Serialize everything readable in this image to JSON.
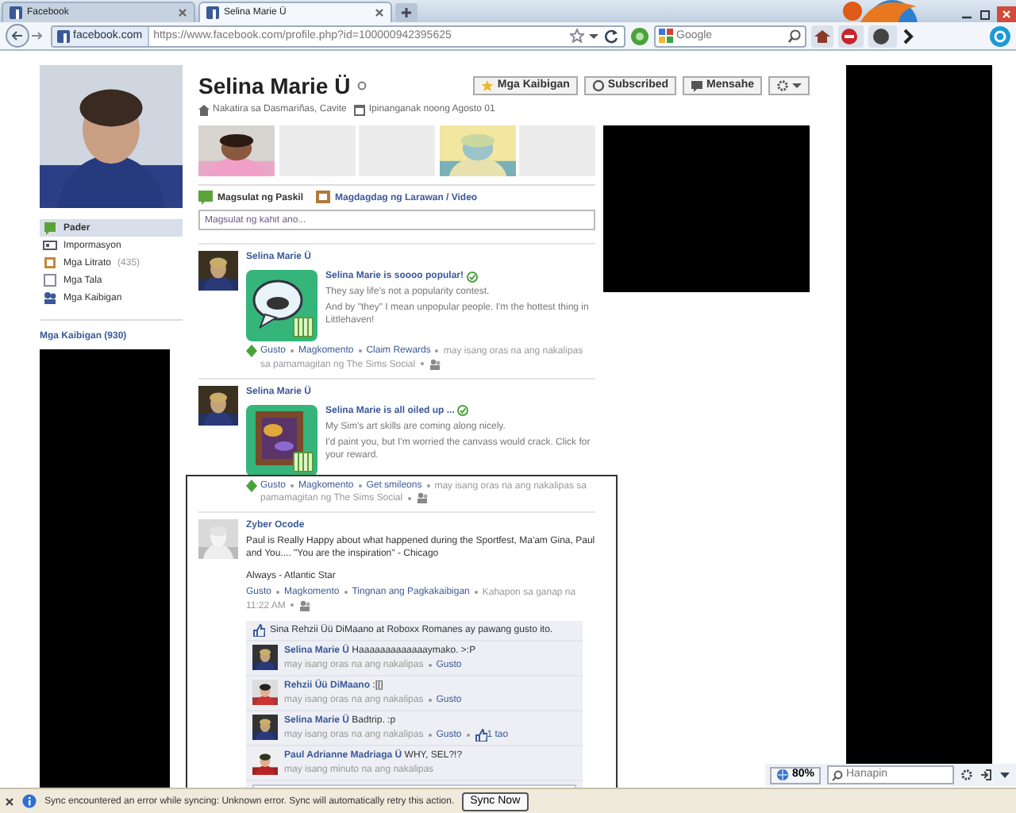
{
  "browser": {
    "tabs": [
      {
        "label": "Facebook",
        "selected": false
      },
      {
        "label": "Selina Marie Ü",
        "selected": true
      }
    ],
    "address": {
      "site": "facebook.com",
      "url": "https://www.facebook.com/profile.php?id=100000942395625"
    },
    "search": {
      "placeholder": "Google"
    }
  },
  "sidebar": {
    "items": [
      {
        "label": "Pader",
        "selected": true
      },
      {
        "label": "Impormasyon",
        "selected": false
      },
      {
        "label": "Mga Litrato",
        "count": "(435)",
        "selected": false
      },
      {
        "label": "Mga Tala",
        "selected": false
      },
      {
        "label": "Mga Kaibigan",
        "selected": false
      }
    ],
    "friends_heading": "Mga Kaibigan (930)"
  },
  "profile": {
    "name": "Selina Marie Ü",
    "info": [
      "Nakatira sa Dasmariñas, Cavite",
      "Ipinanganak noong Agosto 01"
    ],
    "actions": [
      "Mga Kaibigan",
      "Subscribed",
      "Mensahe"
    ],
    "photos": [
      {
        "kind": "picture"
      },
      {
        "kind": "empty"
      },
      {
        "kind": "empty"
      },
      {
        "kind": "picture"
      },
      {
        "kind": "empty"
      }
    ]
  },
  "composer": {
    "tabs": [
      "Magsulat ng Paskil",
      "Magdagdag ng Larawan / Video"
    ],
    "placeholder": "Magsulat ng kahit ano..."
  },
  "posts": [
    {
      "kind": "game",
      "author": "Selina Marie Ü",
      "title": "Selina Marie is soooo popular!",
      "lines": [
        "They say life's not a popularity contest.",
        "And by \"they\" I mean unpopular people. I'm the hottest thing in Littlehaven!"
      ],
      "actions": [
        "Gusto",
        "Magkomento",
        "Claim Rewards"
      ],
      "meta": "may isang oras na ang nakalipas sa pamamagitan ng The Sims Social"
    },
    {
      "kind": "game",
      "author": "Selina Marie Ü",
      "title": "Selina Marie is all oiled up ...",
      "lines": [
        "My Sim's art skills are coming along nicely.",
        "I'd paint you, but I'm worried the canvass would crack. Click for your reward."
      ],
      "actions": [
        "Gusto",
        "Magkomento",
        "Get smileons"
      ],
      "meta": "may isang oras na ang nakalipas sa pamamagitan ng The Sims Social"
    },
    {
      "kind": "status",
      "author": "Zyber Ocode",
      "lines": [
        "Paul is Really Happy about what happened during the Sportfest, Ma'am Gina, Paul and You.... \"You are the inspiration\" - Chicago",
        "Always - Atlantic Star"
      ],
      "actions": [
        "Gusto",
        "Magkomento",
        "Tingnan ang Pagkakaibigan"
      ],
      "meta": "Kahapon sa ganap na 11:22 AM",
      "likes": "Sina Rehzii Üü DiMaano at Roboxx Romanes ay pawang gusto ito.",
      "comments": [
        {
          "author": "Selina Marie Ü",
          "text": "Haaaaaaaaaaaaaymako. >:P",
          "meta": "may isang oras na ang nakalipas",
          "like": "Gusto"
        },
        {
          "author": "Rehzii Üü DiMaano",
          "text": ":[[]",
          "meta": "may isang oras na ang nakalipas",
          "like": "Gusto"
        },
        {
          "author": "Selina Marie Ü",
          "text": "Badtrip. :p",
          "meta": "may isang oras na ang nakalipas",
          "like": "Gusto",
          "like_count": "1 tao"
        },
        {
          "author": "Paul Adrianne Madriaga Ü",
          "text": "WHY, SEL?!?",
          "meta": "may isang minuto na ang nakalipas"
        }
      ]
    }
  ],
  "annotation_frame": {
    "shown": true
  },
  "addon_bar": {
    "zoom": "80%",
    "search_placeholder": "Hanapin"
  },
  "notification": {
    "message": "Sync encountered an error while syncing: Unknown error. Sync will automatically retry this action.",
    "button": "Sync Now"
  }
}
